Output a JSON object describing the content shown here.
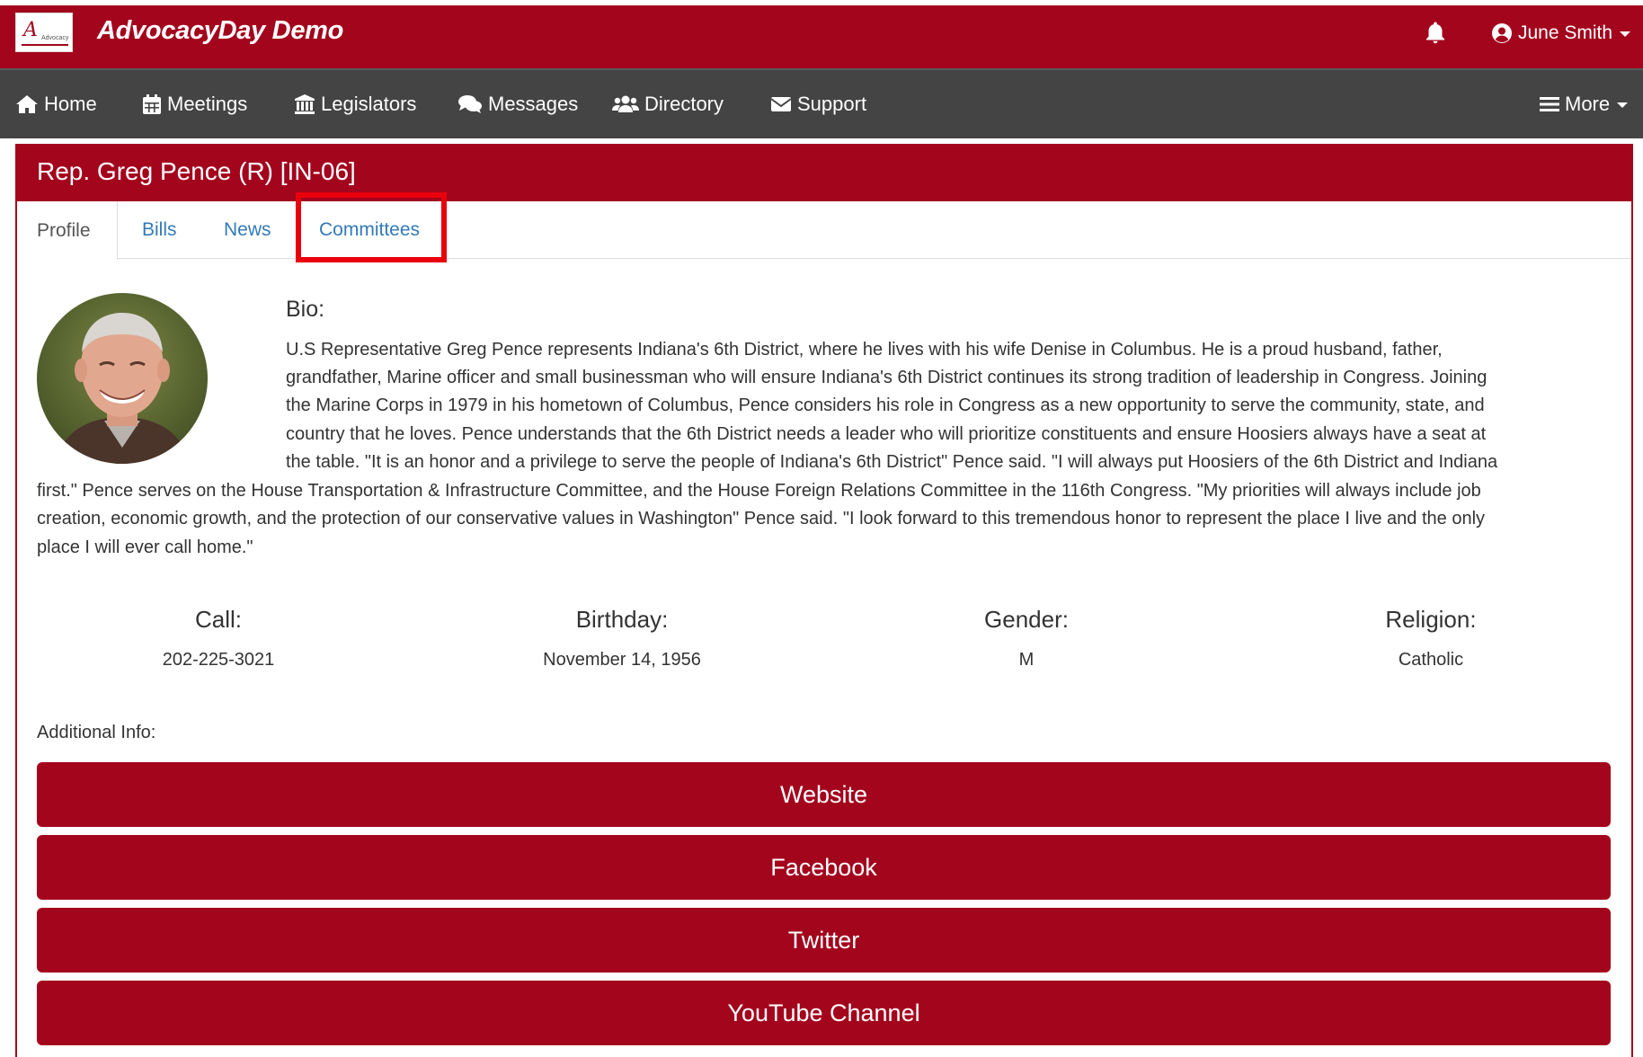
{
  "header": {
    "app_title": "AdvocacyDay Demo",
    "logo_text": "Advocacy",
    "user_name": "June Smith",
    "brand_color": "#a3051d",
    "icons": [
      "bell-icon",
      "user-circle-icon",
      "chevron-down-icon"
    ]
  },
  "nav": {
    "items": [
      {
        "label": "Home",
        "icon": "home-icon"
      },
      {
        "label": "Meetings",
        "icon": "calendar-icon"
      },
      {
        "label": "Legislators",
        "icon": "institution-icon"
      },
      {
        "label": "Messages",
        "icon": "comments-icon"
      },
      {
        "label": "Directory",
        "icon": "users-icon"
      },
      {
        "label": "Support",
        "icon": "envelope-icon"
      }
    ],
    "more_label": "More"
  },
  "panel": {
    "title": "Rep. Greg Pence (R) [IN-06]",
    "tabs": [
      {
        "label": "Profile",
        "active": true
      },
      {
        "label": "Bills"
      },
      {
        "label": "News"
      },
      {
        "label": "Committees",
        "highlighted": true
      }
    ]
  },
  "profile": {
    "bio_label": "Bio:",
    "bio_lines": [
      "U.S Representative Greg Pence represents Indiana's 6th District, where he lives with his wife Denise in Columbus. He is a proud husband, father,",
      "grandfather, Marine officer and small businessman who will ensure Indiana's 6th District continues its strong tradition of leadership in Congress. Joining",
      "the Marine Corps in 1979 in his hometown of Columbus, Pence considers his role in Congress as a new opportunity to serve the community, state, and",
      "country that he loves. Pence understands that the 6th District needs a leader who will prioritize constituents and ensure Hoosiers always have a seat at",
      "the table. \"It is an honor and a privilege to serve the people of Indiana's 6th District\" Pence said. \"I will always put Hoosiers of the 6th District and Indiana",
      "first.\" Pence serves on the House Transportation & Infrastructure Committee, and the House Foreign Relations Committee in the 116th Congress. \"My priorities will always include job",
      "creation, economic growth, and the protection of our conservative values in Washington\" Pence said. \"I look forward to this tremendous honor to represent the place I live and the only",
      "place I will ever call home.\""
    ],
    "stats": [
      {
        "label": "Call:",
        "value": "202-225-3021"
      },
      {
        "label": "Birthday:",
        "value": "November 14, 1956"
      },
      {
        "label": "Gender:",
        "value": "M"
      },
      {
        "label": "Religion:",
        "value": "Catholic"
      }
    ],
    "additional_label": "Additional Info:",
    "links": [
      "Website",
      "Facebook",
      "Twitter",
      "YouTube Channel"
    ]
  }
}
